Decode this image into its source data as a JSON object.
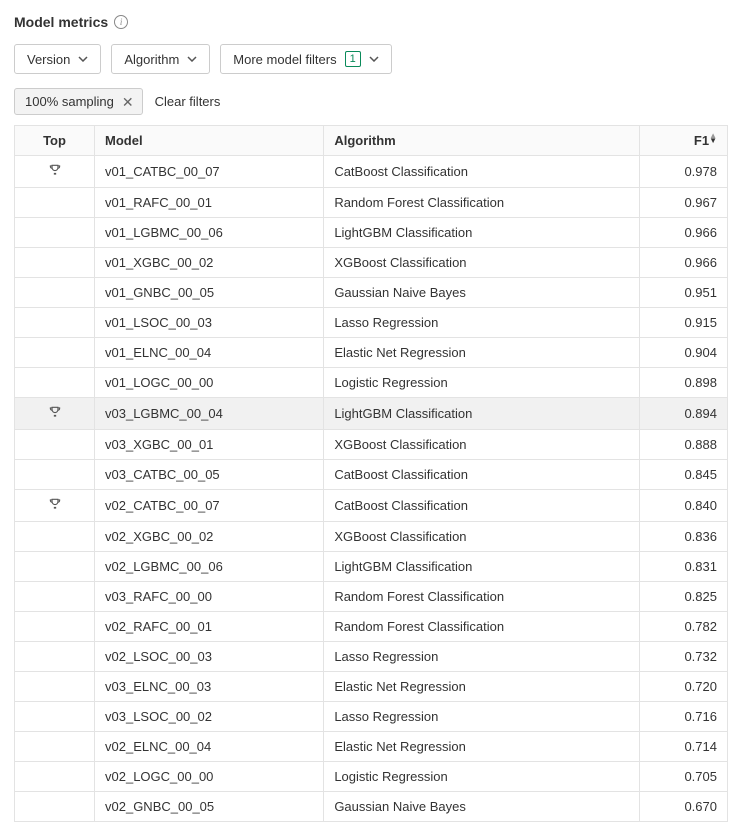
{
  "header": {
    "title": "Model metrics"
  },
  "filters": {
    "version_label": "Version",
    "algorithm_label": "Algorithm",
    "more_label": "More model filters",
    "more_badge": "1"
  },
  "chips": {
    "sampling_label": "100% sampling",
    "clear_label": "Clear filters"
  },
  "columns": {
    "top": "Top",
    "model": "Model",
    "algorithm": "Algorithm",
    "f1": "F1"
  },
  "rows": [
    {
      "top": true,
      "model": "v01_CATBC_00_07",
      "algorithm": "CatBoost Classification",
      "f1": "0.978",
      "hl": false
    },
    {
      "top": false,
      "model": "v01_RAFC_00_01",
      "algorithm": "Random Forest Classification",
      "f1": "0.967",
      "hl": false
    },
    {
      "top": false,
      "model": "v01_LGBMC_00_06",
      "algorithm": "LightGBM Classification",
      "f1": "0.966",
      "hl": false
    },
    {
      "top": false,
      "model": "v01_XGBC_00_02",
      "algorithm": "XGBoost Classification",
      "f1": "0.966",
      "hl": false
    },
    {
      "top": false,
      "model": "v01_GNBC_00_05",
      "algorithm": "Gaussian Naive Bayes",
      "f1": "0.951",
      "hl": false
    },
    {
      "top": false,
      "model": "v01_LSOC_00_03",
      "algorithm": "Lasso Regression",
      "f1": "0.915",
      "hl": false
    },
    {
      "top": false,
      "model": "v01_ELNC_00_04",
      "algorithm": "Elastic Net Regression",
      "f1": "0.904",
      "hl": false
    },
    {
      "top": false,
      "model": "v01_LOGC_00_00",
      "algorithm": "Logistic Regression",
      "f1": "0.898",
      "hl": false
    },
    {
      "top": true,
      "model": "v03_LGBMC_00_04",
      "algorithm": "LightGBM Classification",
      "f1": "0.894",
      "hl": true
    },
    {
      "top": false,
      "model": "v03_XGBC_00_01",
      "algorithm": "XGBoost Classification",
      "f1": "0.888",
      "hl": false
    },
    {
      "top": false,
      "model": "v03_CATBC_00_05",
      "algorithm": "CatBoost Classification",
      "f1": "0.845",
      "hl": false
    },
    {
      "top": true,
      "model": "v02_CATBC_00_07",
      "algorithm": "CatBoost Classification",
      "f1": "0.840",
      "hl": false
    },
    {
      "top": false,
      "model": "v02_XGBC_00_02",
      "algorithm": "XGBoost Classification",
      "f1": "0.836",
      "hl": false
    },
    {
      "top": false,
      "model": "v02_LGBMC_00_06",
      "algorithm": "LightGBM Classification",
      "f1": "0.831",
      "hl": false
    },
    {
      "top": false,
      "model": "v03_RAFC_00_00",
      "algorithm": "Random Forest Classification",
      "f1": "0.825",
      "hl": false
    },
    {
      "top": false,
      "model": "v02_RAFC_00_01",
      "algorithm": "Random Forest Classification",
      "f1": "0.782",
      "hl": false
    },
    {
      "top": false,
      "model": "v02_LSOC_00_03",
      "algorithm": "Lasso Regression",
      "f1": "0.732",
      "hl": false
    },
    {
      "top": false,
      "model": "v03_ELNC_00_03",
      "algorithm": "Elastic Net Regression",
      "f1": "0.720",
      "hl": false
    },
    {
      "top": false,
      "model": "v03_LSOC_00_02",
      "algorithm": "Lasso Regression",
      "f1": "0.716",
      "hl": false
    },
    {
      "top": false,
      "model": "v02_ELNC_00_04",
      "algorithm": "Elastic Net Regression",
      "f1": "0.714",
      "hl": false
    },
    {
      "top": false,
      "model": "v02_LOGC_00_00",
      "algorithm": "Logistic Regression",
      "f1": "0.705",
      "hl": false
    },
    {
      "top": false,
      "model": "v02_GNBC_00_05",
      "algorithm": "Gaussian Naive Bayes",
      "f1": "0.670",
      "hl": false
    }
  ]
}
